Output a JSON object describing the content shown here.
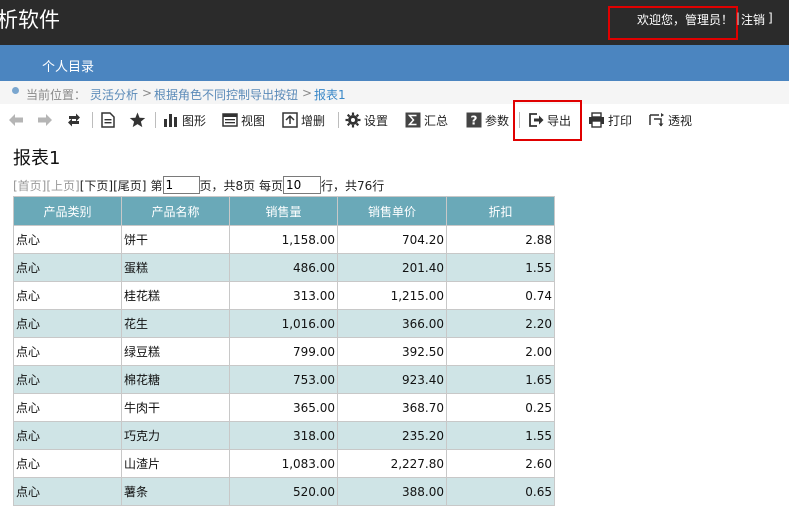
{
  "header": {
    "app_title": "析软件",
    "welcome": "欢迎您，管理员！",
    "separator": "|",
    "logout": "注销",
    "logout_bracket": "]"
  },
  "nav": {
    "items": [
      {
        "label": "个人目录"
      }
    ]
  },
  "breadcrumb": {
    "prefix": "当前位置：",
    "items": [
      "灵活分析",
      "根据角色不同控制导出按钮",
      "报表1"
    ],
    "separator": ">"
  },
  "toolbar": {
    "icons": [
      "arrow-left-icon",
      "arrow-right-icon",
      "refresh-icon",
      "document-icon",
      "star-icon"
    ],
    "buttons": [
      {
        "label": "图形",
        "icon": "bar-chart-icon"
      },
      {
        "label": "视图",
        "icon": "view-icon"
      },
      {
        "label": "增删",
        "icon": "edit-table-icon"
      },
      {
        "label": "设置",
        "icon": "gear-icon"
      },
      {
        "label": "汇总",
        "icon": "sigma-icon"
      },
      {
        "label": "参数",
        "icon": "question-icon"
      },
      {
        "label": "导出",
        "icon": "export-icon"
      },
      {
        "label": "打印",
        "icon": "printer-icon"
      },
      {
        "label": "透视",
        "icon": "pivot-icon"
      }
    ]
  },
  "report": {
    "title": "报表1",
    "pager": {
      "first": "[首页]",
      "prev": "[上页]",
      "next": "[下页]",
      "last": "[尾页]",
      "page_prefix": "第",
      "page_value": "1",
      "page_suffix": "页，共8页 每页",
      "size_value": "10",
      "size_suffix": "行，共76行"
    },
    "columns": [
      "产品类别",
      "产品名称",
      "销售量",
      "销售单价",
      "折扣"
    ],
    "rows": [
      [
        "点心",
        "饼干",
        "1,158.00",
        "704.20",
        "2.88"
      ],
      [
        "点心",
        "蛋糕",
        "486.00",
        "201.40",
        "1.55"
      ],
      [
        "点心",
        "桂花糕",
        "313.00",
        "1,215.00",
        "0.74"
      ],
      [
        "点心",
        "花生",
        "1,016.00",
        "366.00",
        "2.20"
      ],
      [
        "点心",
        "绿豆糕",
        "799.00",
        "392.50",
        "2.00"
      ],
      [
        "点心",
        "棉花糖",
        "753.00",
        "923.40",
        "1.65"
      ],
      [
        "点心",
        "牛肉干",
        "365.00",
        "368.70",
        "0.25"
      ],
      [
        "点心",
        "巧克力",
        "318.00",
        "235.20",
        "1.55"
      ],
      [
        "点心",
        "山渣片",
        "1,083.00",
        "2,227.80",
        "2.60"
      ],
      [
        "点心",
        "薯条",
        "520.00",
        "388.00",
        "0.65"
      ]
    ]
  },
  "colors": {
    "header_bg": "#2b2b2b",
    "nav_bg": "#4b85c0",
    "table_header_bg": "#6aa9b8",
    "table_alt_row": "#cfe4e6",
    "highlight_border": "#e00000"
  }
}
